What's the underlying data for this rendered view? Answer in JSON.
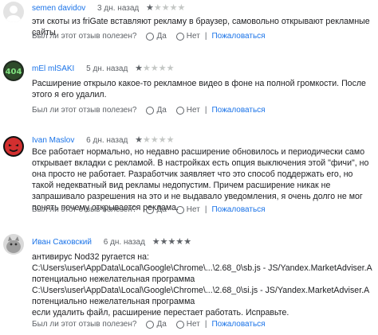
{
  "reviews": [
    {
      "author": "semen davidov",
      "date": "3 дн. назад",
      "rating": 1,
      "avatar_icon": "default-person-avatar",
      "text": "эти скоты из friGate вставляют рекламу в браузер, самовольно открывают рекламные сайты"
    },
    {
      "author": "mEl mlSAKI",
      "date": "5 дн. назад",
      "rating": 1,
      "avatar_icon": "404-avatar",
      "text": "Расширение открыло какое-то рекламное видео в фоне на полной громкости. После этого я его удалил."
    },
    {
      "author": "Ivan Maslov",
      "date": "6 дн. назад",
      "rating": 1,
      "avatar_icon": "red-face-avatar",
      "text": "Все работает нормально, но недавно расширение обновилось и периодически само открывает вкладки с рекламой. В настройках есть опция выключения этой \"фичи\", но она просто не работает. Разработчик заявляет что это способ поддержать его, но такой недекватный вид рекламы недопустим. Причем расширение никак не запрашивало разрешения на это и не выдавало уведомления, я очень долго не мог понять почему открывается реклама."
    },
    {
      "author": "Иван Саковский",
      "date": "6 дн. назад",
      "rating": 5,
      "avatar_icon": "grey-kitten-avatar",
      "text": "антивирус Nod32 ругается на:\nC:\\Users\\user\\AppData\\Local\\Google\\Chrome\\...\\2.68_0\\sb.js - JS/Yandex.MarketAdviser.A потенциально нежелательная программа\nC:\\Users\\user\\AppData\\Local\\Google\\Chrome\\...\\2.68_0\\si.js - JS/Yandex.MarketAdviser.A потенциально нежелательная программа\nесли удалить файл, расширение перестает работать. Исправьте."
    }
  ],
  "helpful": {
    "question": "Был ли этот отзыв полезен?",
    "yes": "Да",
    "no": "Нет",
    "separator": "|",
    "report": "Пожаловаться"
  },
  "star_glyph": "★"
}
